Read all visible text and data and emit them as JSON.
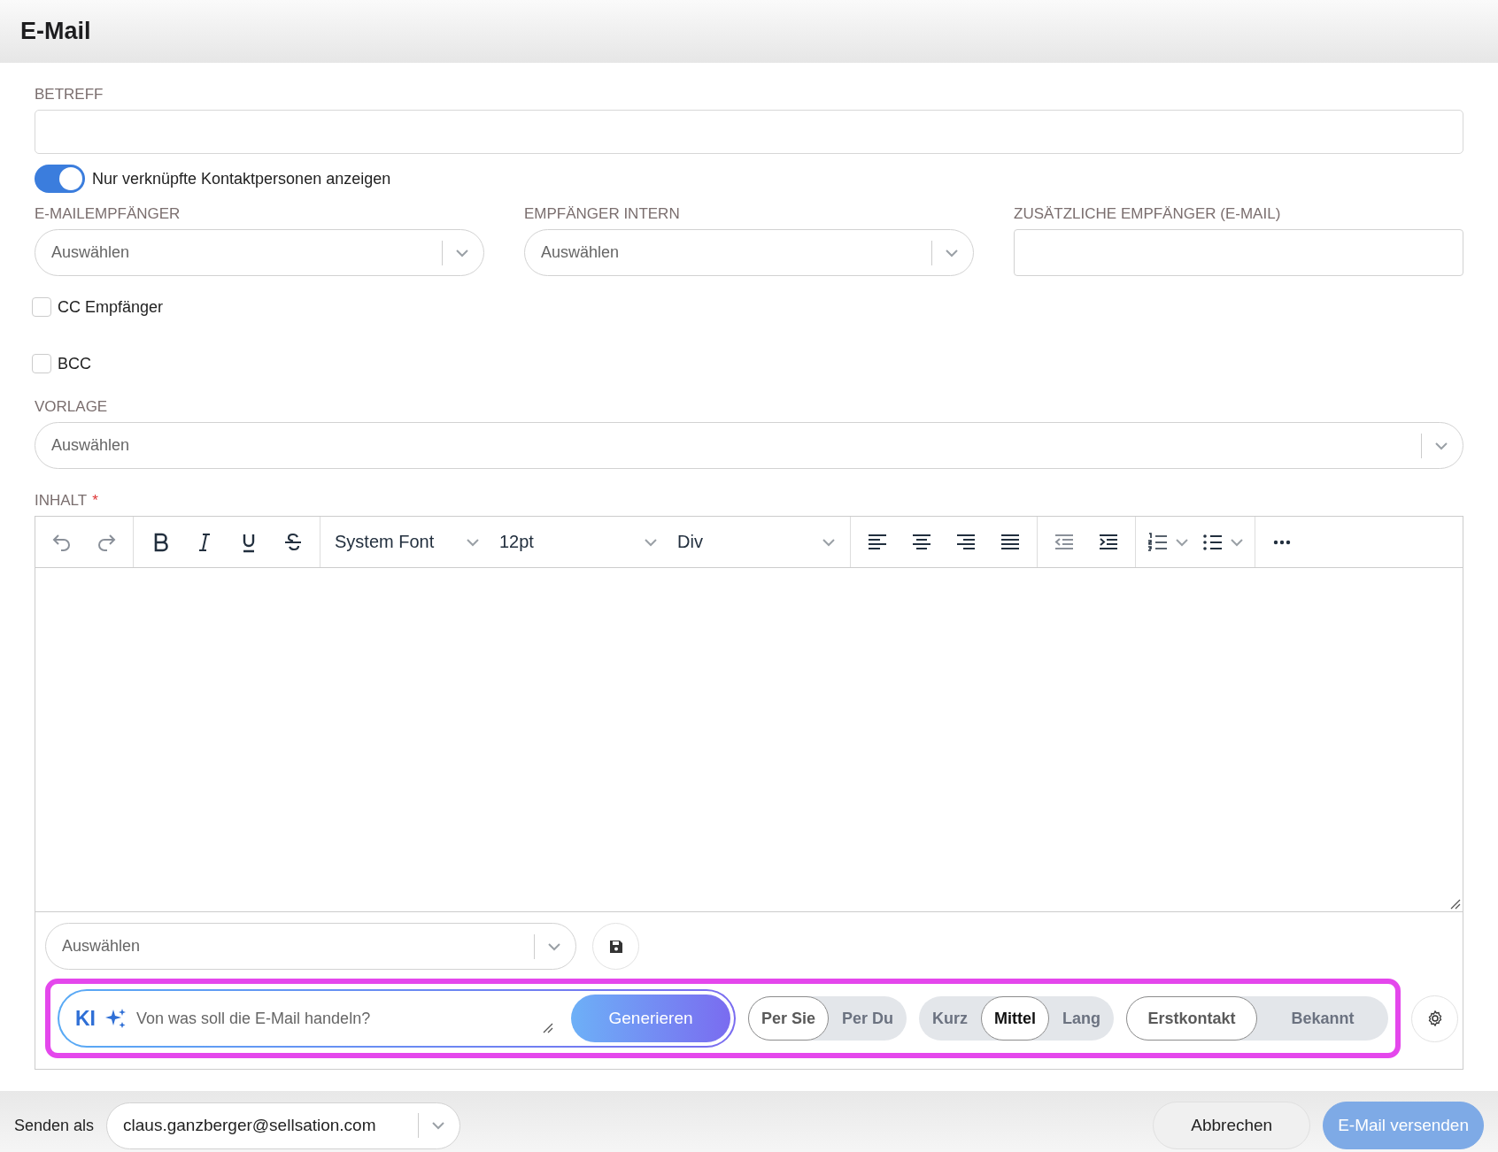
{
  "header": {
    "title": "E-Mail"
  },
  "subject": {
    "label": "BETREFF"
  },
  "linked_toggle": {
    "label": "Nur verknüpfte Kontaktpersonen anzeigen",
    "on": true
  },
  "recipients": [
    {
      "label": "E-MAILEMPFÄNGER",
      "kind": "select",
      "placeholder": "Auswählen"
    },
    {
      "label": "EMPFÄNGER INTERN",
      "kind": "select",
      "placeholder": "Auswählen"
    },
    {
      "label": "ZUSÄTZLICHE EMPFÄNGER (E-MAIL)",
      "kind": "text"
    }
  ],
  "checkboxes": [
    {
      "label": "CC Empfänger",
      "checked": false
    },
    {
      "label": "BCC",
      "checked": false
    }
  ],
  "template": {
    "label": "VORLAGE",
    "placeholder": "Auswählen"
  },
  "content": {
    "label": "INHALT",
    "required_mark": "*",
    "toolbar": [
      [
        {
          "kind": "undo",
          "disabled": true
        },
        {
          "kind": "redo",
          "disabled": true
        }
      ],
      [
        {
          "kind": "bold",
          "disabled": false
        },
        {
          "kind": "italic",
          "disabled": false
        },
        {
          "kind": "underline",
          "disabled": false
        },
        {
          "kind": "strike",
          "disabled": false
        }
      ],
      [
        {
          "kind": "dropdown",
          "value": "System Font"
        },
        {
          "kind": "dropdown",
          "value": "12pt"
        },
        {
          "kind": "dropdown",
          "value": "Div"
        }
      ],
      [
        {
          "kind": "align-left",
          "disabled": false
        },
        {
          "kind": "align-center",
          "disabled": false
        },
        {
          "kind": "align-right",
          "disabled": false
        },
        {
          "kind": "justify",
          "disabled": false
        }
      ],
      [
        {
          "kind": "outdent",
          "disabled": true
        },
        {
          "kind": "indent",
          "disabled": false
        }
      ],
      [
        {
          "kind": "numbered-list"
        },
        {
          "kind": "bullet-list"
        }
      ],
      [
        {
          "kind": "more",
          "disabled": false
        }
      ]
    ],
    "signature_select": {
      "placeholder": "Auswählen"
    }
  },
  "ai": {
    "badge": "KI",
    "placeholder": "Von was soll die E-Mail handeln?",
    "button": "Generieren",
    "option_groups": [
      [
        {
          "label": "Per Sie",
          "selected": true
        },
        {
          "label": "Per Du",
          "selected": false
        }
      ],
      [
        {
          "label": "Kurz",
          "selected": false
        },
        {
          "label": "Mittel",
          "selected": true
        },
        {
          "label": "Lang",
          "selected": false
        }
      ],
      [
        {
          "label": "Erstkontakt",
          "selected": true
        },
        {
          "label": "Bekannt",
          "selected": false
        }
      ]
    ]
  },
  "footer": {
    "sender_label": "Senden als",
    "sender": "claus.ganzberger@sellsation.com",
    "buttons": [
      {
        "label": "Abbrechen",
        "kind": "secondary",
        "disabled": false
      },
      {
        "label": "E-Mail versenden",
        "kind": "primary",
        "disabled": true
      }
    ]
  }
}
